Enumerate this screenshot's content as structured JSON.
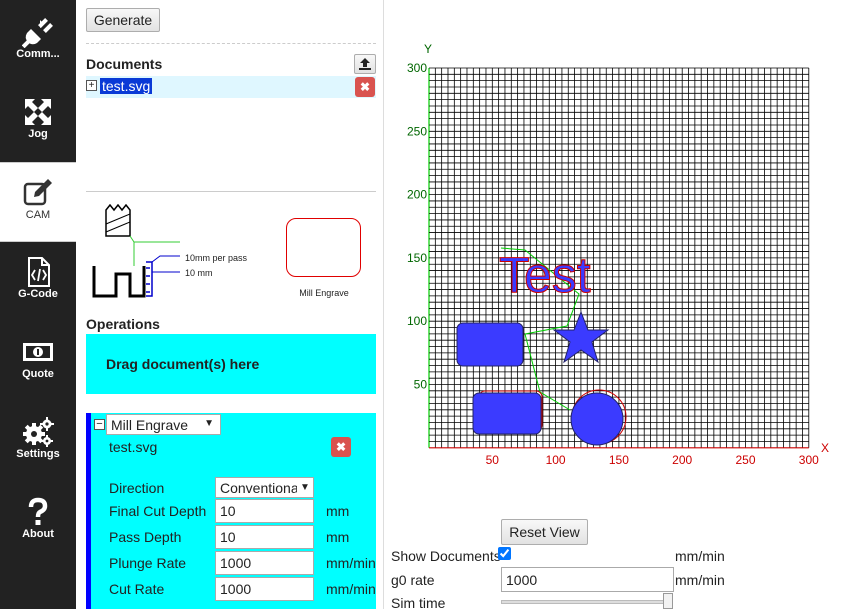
{
  "nav": {
    "items": [
      {
        "id": "comms",
        "label": "Comm...",
        "icon": "plug-icon",
        "active": false
      },
      {
        "id": "jog",
        "label": "Jog",
        "icon": "arrows-move-icon",
        "active": false
      },
      {
        "id": "cam",
        "label": "CAM",
        "icon": "edit-icon",
        "active": true
      },
      {
        "id": "gcode",
        "label": "G-Code",
        "icon": "code-file-icon",
        "active": false
      },
      {
        "id": "quote",
        "label": "Quote",
        "icon": "money-icon",
        "active": false
      },
      {
        "id": "settings",
        "label": "Settings",
        "icon": "gears-icon",
        "active": false
      },
      {
        "id": "about",
        "label": "About",
        "icon": "question-icon",
        "active": false
      }
    ]
  },
  "cam": {
    "generate_label": "Generate",
    "documents_title": "Documents",
    "document_name": "test.svg",
    "diagram": {
      "per_pass_label": "10mm per pass",
      "depth_label": "10 mm",
      "preview_caption": "Mill Engrave"
    },
    "operations_title": "Operations",
    "drop_hint": "Drag document(s) here",
    "operation": {
      "type": "Mill Engrave",
      "document": "test.svg",
      "fields": {
        "direction_label": "Direction",
        "direction_value": "Conventional",
        "final_cut_depth_label": "Final Cut Depth",
        "final_cut_depth_value": "10",
        "final_cut_depth_unit": "mm",
        "pass_depth_label": "Pass Depth",
        "pass_depth_value": "10",
        "pass_depth_unit": "mm",
        "plunge_rate_label": "Plunge Rate",
        "plunge_rate_value": "1000",
        "plunge_rate_unit": "mm/min",
        "cut_rate_label": "Cut Rate",
        "cut_rate_value": "1000",
        "cut_rate_unit": "mm/min"
      }
    }
  },
  "viewer": {
    "axis_y_label": "Y",
    "axis_x_label": "X",
    "x_ticks": [
      "50",
      "100",
      "150",
      "200",
      "250",
      "300"
    ],
    "y_ticks": [
      "300",
      "250",
      "200",
      "150",
      "100",
      "50"
    ],
    "design_text": "Test",
    "reset_view_label": "Reset View",
    "show_documents_label": "Show Documents",
    "show_documents_checked": true,
    "show_documents_unit": "mm/min",
    "g0_rate_label": "g0 rate",
    "g0_rate_value": "1000",
    "g0_rate_unit": "mm/min",
    "sim_time_label": "Sim time"
  },
  "colors": {
    "nav_bg": "#222222",
    "accent_cyan": "#00ffff",
    "op_bar": "#0000ff",
    "delete_red": "#d9534f",
    "grid_line": "#000000",
    "y_axis": "#00cc00",
    "x_axis": "#cc0000",
    "shape_fill": "#3b3bff",
    "shape_outline": "#ff0000",
    "toolpath": "#00cc00"
  }
}
